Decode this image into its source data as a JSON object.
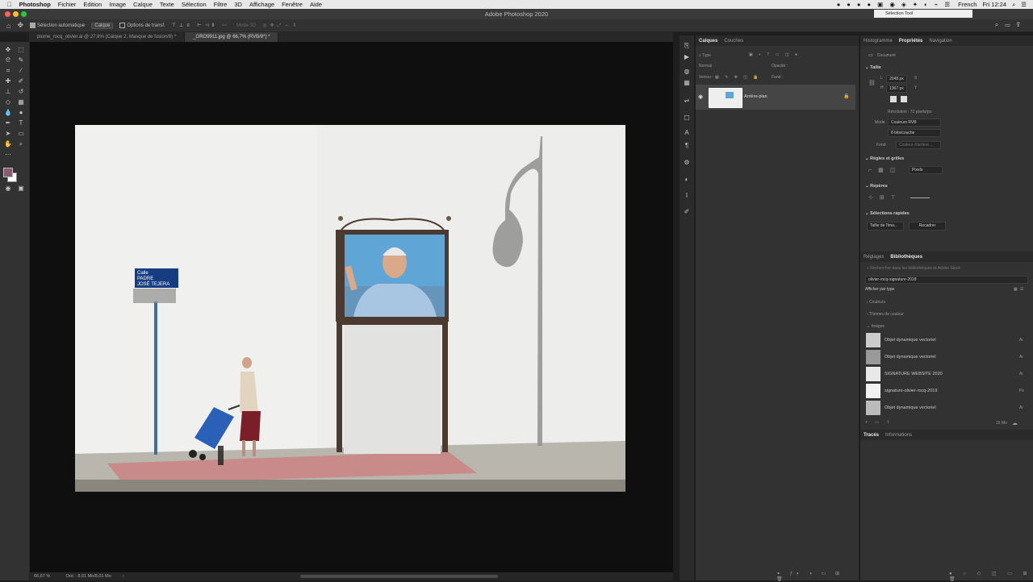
{
  "menubar": {
    "app": "Photoshop",
    "items": [
      "Fichier",
      "Edition",
      "Image",
      "Calque",
      "Texte",
      "Sélection",
      "Filtre",
      "3D",
      "Affichage",
      "Fenêtre",
      "Aide"
    ],
    "language": "French",
    "clock": "Fri 12:24"
  },
  "window": {
    "title": "Adobe Photoshop 2020",
    "tooltip": "Sélection Tool"
  },
  "options": {
    "auto_select": "Sélection automatique",
    "layer_select": "Calque",
    "transform": "Options de transf.",
    "mode3d": "Mode 3D"
  },
  "tabs": [
    {
      "label": "plume_rocq_olivier.ai @ 27,8% (Calque 2, Masque de fusion/8) *"
    },
    {
      "label": "_ORO9911.jpg @ 66,7% (RVB/8*) *"
    }
  ],
  "status": {
    "zoom": "66,67 %",
    "doc": "Doc : 8,01 Mo/8,01 Mo"
  },
  "layers": {
    "tabs": [
      "Calques",
      "Couches"
    ],
    "search": "Type",
    "blend": "Normal",
    "opacity_label": "Opacité :",
    "lock_label": "Verrou :",
    "fill_label": "Fond :",
    "layer_name": "Arrière-plan"
  },
  "properties": {
    "tabs": [
      "Histogramme",
      "Propriétés",
      "Navigation"
    ],
    "doc_label": "Document",
    "size_section": "Taille",
    "width": "2048 px",
    "height": "1367 px",
    "w_label": "L",
    "h_label": "H",
    "x_label": "X",
    "y_label": "Y",
    "resolution": "Résolution : 72 pixels/po",
    "mode_label": "Mode",
    "mode": "Couleurs RVB",
    "depth": "8 bits/couche",
    "fill_label": "Fond",
    "fill": "Couleur d'arrière...",
    "rules_section": "Règles et grilles",
    "units": "Pixels",
    "guides_section": "Repères",
    "quick_section": "Sélections rapides",
    "btn_trim": "Taille de l'ima...",
    "btn_crop": "Recadrer"
  },
  "libraries": {
    "tabs": [
      "Réglages",
      "Bibliothèques"
    ],
    "search": "Rechercher dans les bibliothèques et Adobe Stock",
    "library": "olivier-rocq-signature-2018",
    "view": "Afficher par type",
    "groups": [
      "Couleurs",
      "Thèmes de couleur",
      "Images"
    ],
    "items": [
      {
        "name": "Objet dynamique vectoriel",
        "badge": "Ai"
      },
      {
        "name": "Objet dynamique vectoriel",
        "badge": "Ai"
      },
      {
        "name": "SIGNATURE WEBSITE 2020",
        "badge": "Ai"
      },
      {
        "name": "signature-olivier-rocq-2019",
        "badge": "Ps"
      },
      {
        "name": "Objet dynamique vectoriel",
        "badge": "Ai"
      }
    ],
    "size": "16 Mo"
  },
  "bottom_tabs": [
    "Tracés",
    "Informations"
  ],
  "photo": {
    "sign_line1": "Calle",
    "sign_line2": "PADRE",
    "sign_line3": "JOSÉ TEJERA"
  },
  "colors": {
    "accent": "#1473e6",
    "fg_swatch": "#8a5a6e",
    "bg_swatch": "#ffffff"
  },
  "icons": [
    "apple-icon",
    "move-tool-icon",
    "marquee-tool-icon",
    "lasso-tool-icon",
    "crop-tool-icon",
    "eyedropper-icon",
    "brush-tool-icon",
    "eraser-icon",
    "type-tool-icon",
    "hand-tool-icon",
    "zoom-tool-icon",
    "eye-icon",
    "lock-icon",
    "search-icon",
    "gear-icon",
    "cloud-icon"
  ]
}
